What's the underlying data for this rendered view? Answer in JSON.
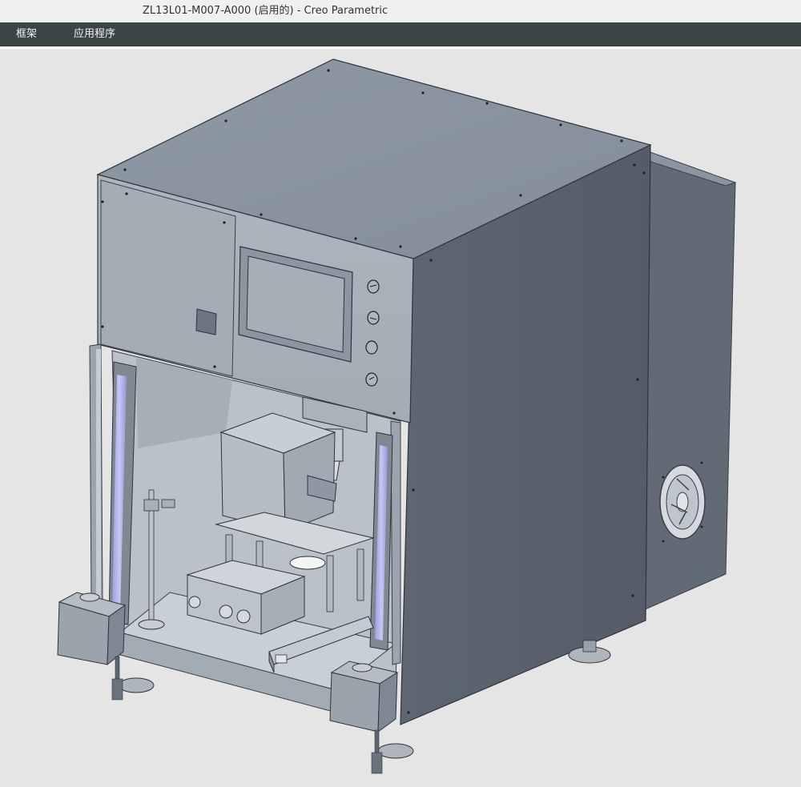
{
  "window": {
    "title": "ZL13L01-M007-A000 (启用的) - Creo Parametric"
  },
  "menubar": {
    "items": [
      {
        "label": "框架"
      },
      {
        "label": "应用程序"
      }
    ]
  },
  "viewport": {
    "background": "#e5e5e6",
    "model_colors": {
      "top": "#8f9aa6",
      "front": "#a9b1ba",
      "side": "#5c6470",
      "rear_box": "#6a727d",
      "inner": "#bfc6cd",
      "light_curtain": "#a7a9e6"
    }
  }
}
